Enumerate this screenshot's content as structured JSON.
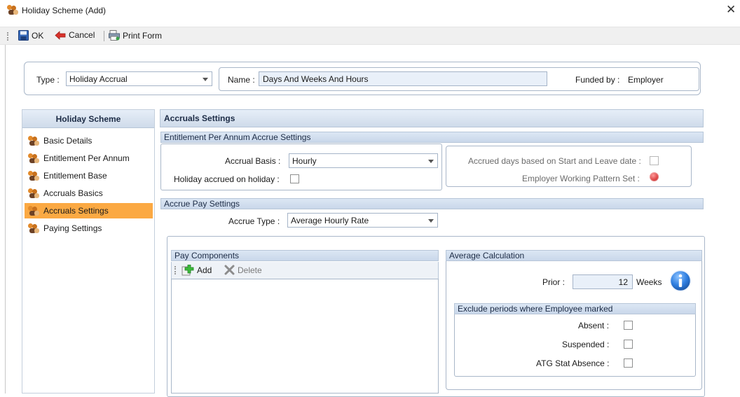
{
  "window": {
    "title": "Holiday Scheme (Add)",
    "close": "✕"
  },
  "toolbar": {
    "ok_label": "OK",
    "cancel_label": "Cancel",
    "print_label": "Print Form"
  },
  "top": {
    "type_label": "Type :",
    "type_value": "Holiday Accrual",
    "name_label": "Name :",
    "name_value": "Days And Weeks And Hours",
    "funded_label": "Funded by :",
    "funded_value": "Employer"
  },
  "nav": {
    "header": "Holiday Scheme",
    "items": [
      {
        "label": "Basic Details"
      },
      {
        "label": "Entitlement Per Annum"
      },
      {
        "label": "Entitlement Base"
      },
      {
        "label": "Accruals Basics"
      },
      {
        "label": "Accruals Settings",
        "active": true
      },
      {
        "label": "Paying Settings"
      }
    ]
  },
  "main": {
    "header": "Accruals Settings",
    "entitlement": {
      "header": "Entitlement Per Annum Accrue Settings",
      "basis_label": "Accrual Basis :",
      "basis_value": "Hourly",
      "on_holiday_label": "Holiday accrued on holiday :",
      "start_leave_label": "Accrued days based on Start and Leave date :",
      "pattern_label": "Employer Working Pattern Set :"
    },
    "accrue_pay": {
      "header": "Accrue Pay Settings",
      "type_label": "Accrue Type :",
      "type_value": "Average Hourly Rate"
    },
    "pay_components": {
      "header": "Pay Components",
      "add_label": "Add",
      "delete_label": "Delete"
    },
    "average": {
      "header": "Average Calculation",
      "prior_label": "Prior :",
      "prior_value": "12",
      "weeks_label": "Weeks",
      "exclude_header": "Exclude periods where Employee marked",
      "absent_label": "Absent :",
      "suspended_label": "Suspended :",
      "atg_label": "ATG Stat Absence :"
    }
  },
  "colors": {
    "active_nav": "#fba943",
    "header_blue": "#cfdbea",
    "info_icon": "#2f7ee0"
  }
}
